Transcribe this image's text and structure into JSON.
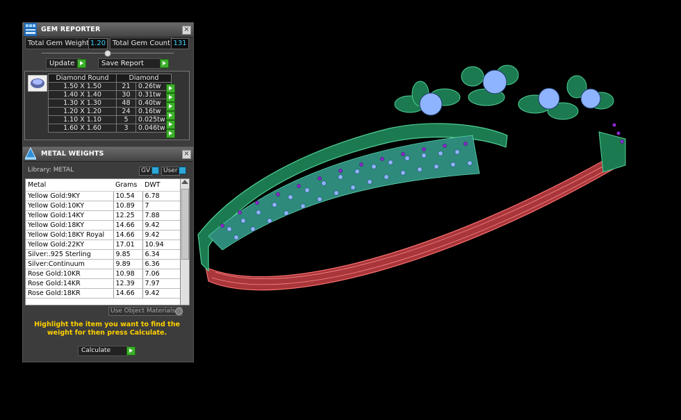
{
  "gem_reporter": {
    "title": "GEM REPORTER",
    "total_gem_weight_label": "Total Gem Weight",
    "total_gem_weight_value": "1.20",
    "total_gem_count_label": "Total Gem Count",
    "total_gem_count_value": "131",
    "update_label": "Update",
    "save_report_label": "Save Report",
    "table_header_shape": "Diamond Round",
    "table_header_type": "Diamond",
    "rows": [
      {
        "size": "1.50 X 1.50",
        "count": "21",
        "tw": "0.26tw"
      },
      {
        "size": "1.40 X 1.40",
        "count": "30",
        "tw": "0.31tw"
      },
      {
        "size": "1.30 X 1.30",
        "count": "48",
        "tw": "0.40tw"
      },
      {
        "size": "1.20 X 1.20",
        "count": "24",
        "tw": "0.16tw"
      },
      {
        "size": "1.10 X 1.10",
        "count": "5",
        "tw": "0.025tw"
      },
      {
        "size": "1.60 X 1.60",
        "count": "3",
        "tw": "0.046tw"
      }
    ]
  },
  "metal_weights": {
    "title": "METAL WEIGHTS",
    "library_label": "Library: METAL",
    "gv_label": "GV",
    "user_label": "User",
    "columns": [
      "Metal",
      "Grams",
      "DWT"
    ],
    "rows": [
      {
        "metal": "Yellow Gold:9KY",
        "grams": "10.54",
        "dwt": "6.78"
      },
      {
        "metal": "Yellow Gold:10KY",
        "grams": "10.89",
        "dwt": "7"
      },
      {
        "metal": "Yellow Gold:14KY",
        "grams": "12.25",
        "dwt": "7.88"
      },
      {
        "metal": "Yellow Gold:18KY",
        "grams": "14.66",
        "dwt": "9.42"
      },
      {
        "metal": "Yellow Gold:18KY Royal",
        "grams": "14.66",
        "dwt": "9.42"
      },
      {
        "metal": "Yellow Gold:22KY",
        "grams": "17.01",
        "dwt": "10.94"
      },
      {
        "metal": "Silver:.925 Sterling",
        "grams": "9.85",
        "dwt": "6.34"
      },
      {
        "metal": "Silver:Continuum",
        "grams": "9.89",
        "dwt": "6.36"
      },
      {
        "metal": "Rose Gold:10KR",
        "grams": "10.98",
        "dwt": "7.06"
      },
      {
        "metal": "Rose Gold:14KR",
        "grams": "12.39",
        "dwt": "7.97"
      },
      {
        "metal": "Rose Gold:18KR",
        "grams": "14.66",
        "dwt": "9.42"
      }
    ],
    "use_object_materials_label": "Use Object Materials",
    "hint_text": "Highlight the item you want to find the weight for then press Calculate.",
    "calculate_label": "Calculate"
  },
  "colors": {
    "value_text": "#3fd3ff",
    "go_button": "#3db02b",
    "hint_text": "#ffd000",
    "band_green": "#1f8a5a",
    "band_red": "#c24a4a",
    "gem_blue": "#8fb4ff",
    "gem_purple": "#8a2ad0"
  }
}
